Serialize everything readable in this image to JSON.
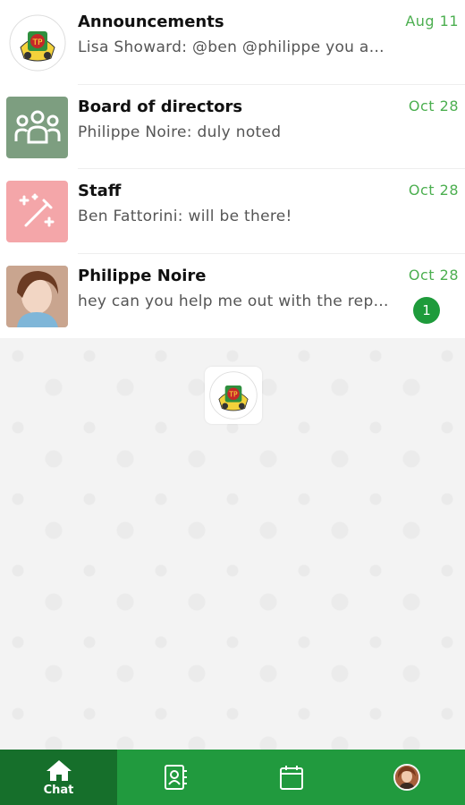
{
  "chats": [
    {
      "name": "Announcements",
      "preview": "Lisa Showard: @ben @philippe you are needed",
      "date": "Aug 11",
      "avatar": "school-logo",
      "unread": null
    },
    {
      "name": "Board of directors",
      "preview": "Philippe Noire: duly noted",
      "date": "Oct 28",
      "avatar": "group-icon",
      "avatar_color": "#7d9e80",
      "unread": null
    },
    {
      "name": "Staff",
      "preview": "Ben Fattorini: will be there!",
      "date": "Oct 28",
      "avatar": "magic-wand-icon",
      "avatar_color": "#f4a6a9",
      "unread": null
    },
    {
      "name": "Philippe Noire",
      "preview": "hey can you help me out with the report?",
      "date": "Oct 28",
      "avatar": "user-photo",
      "unread": "1"
    }
  ],
  "bottom_nav": {
    "chat_label": "Chat",
    "items": [
      "home-icon",
      "contacts-icon",
      "calendar-icon",
      "profile-avatar"
    ]
  },
  "colors": {
    "accent_green": "#219a3e",
    "active_tab": "#166f2b",
    "date_green": "#4caf50",
    "badge_green": "#1e9b3b"
  }
}
